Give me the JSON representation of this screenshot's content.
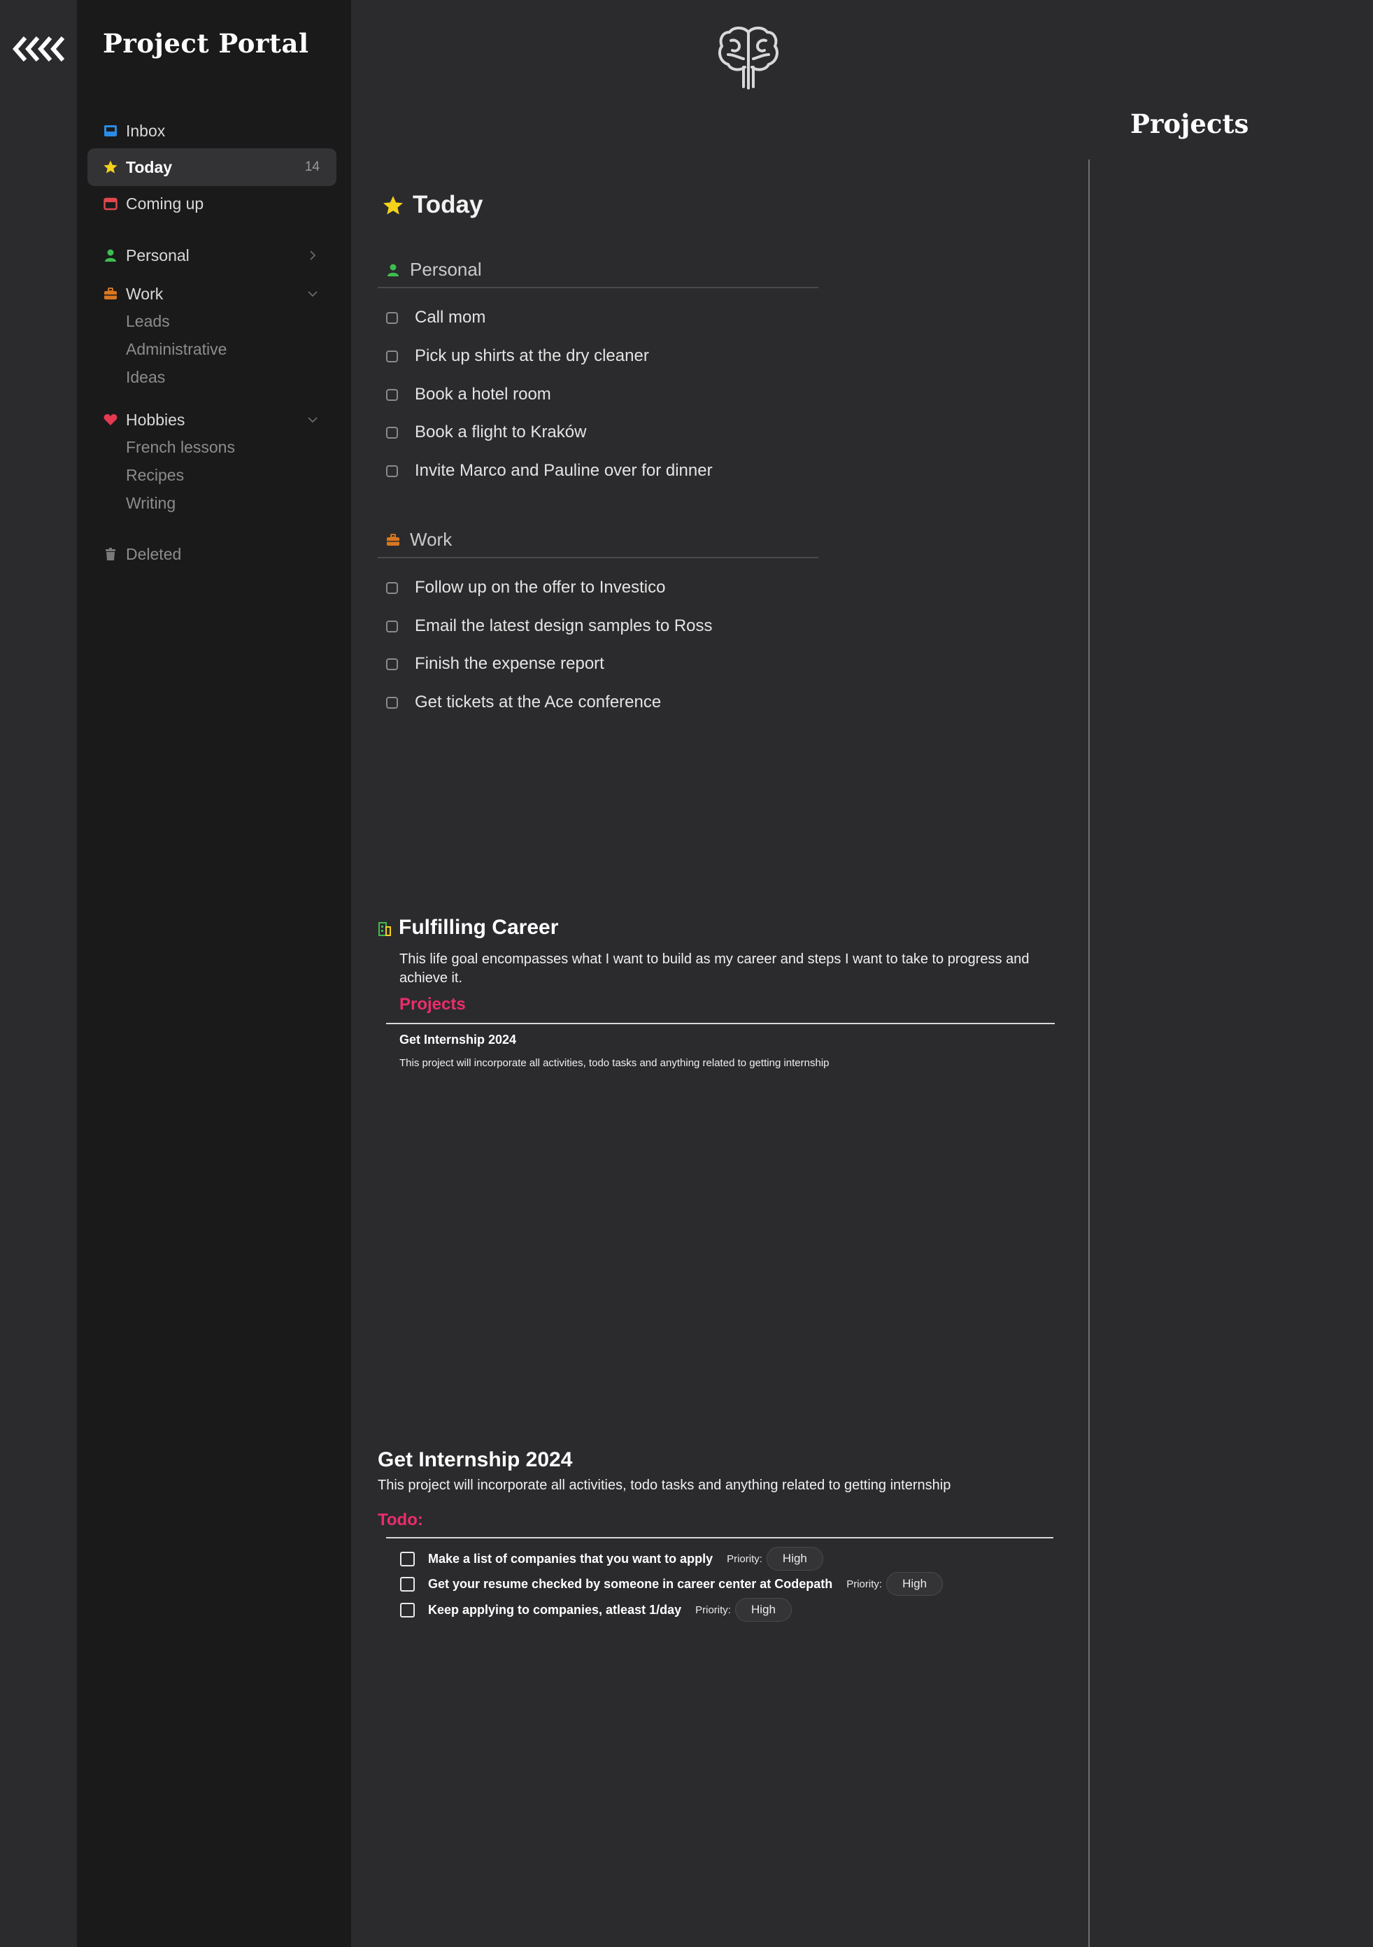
{
  "app": {
    "brand": "Project Portal",
    "right_heading": "Projects"
  },
  "colors": {
    "background": "#2b2b2d",
    "sidebar": "#1a1a1b",
    "accent_pink": "#ec2d6b",
    "inbox_blue": "#2a8ce8",
    "star_yellow": "#f4d21c",
    "calendar_red": "#e0474c",
    "person_green": "#3ebd4f",
    "work_orange": "#d8771f",
    "heart_red": "#e53950"
  },
  "sidebar": {
    "items": [
      {
        "label": "Inbox",
        "icon": "inbox-icon"
      },
      {
        "label": "Today",
        "icon": "star-icon",
        "count": "14",
        "active": true
      },
      {
        "label": "Coming up",
        "icon": "calendar-icon"
      },
      {
        "label": "Personal",
        "icon": "person-icon"
      },
      {
        "label": "Work",
        "icon": "briefcase-icon",
        "children": [
          "Leads",
          "Administrative",
          "Ideas"
        ]
      },
      {
        "label": "Hobbies",
        "icon": "heart-icon",
        "children": [
          "French lessons",
          "Recipes",
          "Writing"
        ]
      },
      {
        "label": "Deleted",
        "icon": "trash-icon"
      }
    ]
  },
  "today": {
    "title": "Today",
    "sections": [
      {
        "name": "Personal",
        "icon": "person-icon",
        "tasks": [
          "Call mom",
          "Pick up shirts at the dry cleaner",
          "Book a hotel room",
          "Book a flight to Kraków",
          "Invite Marco and Pauline over for dinner"
        ]
      },
      {
        "name": "Work",
        "icon": "briefcase-icon",
        "tasks": [
          "Follow up on the offer to Investico",
          "Email the latest design samples to Ross",
          "Finish the expense report",
          "Get tickets at the Ace conference"
        ]
      }
    ]
  },
  "goal": {
    "title": "Fulfilling Career",
    "description": "This life goal encompasses what I want to build as my career and steps I want to take to progress and achieve it.",
    "projects_label": "Projects",
    "projects": [
      {
        "title": "Get Internship 2024",
        "description": "This project will incorporate all activities, todo tasks and anything related to getting internship"
      }
    ]
  },
  "project": {
    "title": "Get Internship 2024",
    "description": "This project will incorporate all activities, todo tasks and anything related to getting internship",
    "todo_label": "Todo:",
    "todos": [
      {
        "text": "Make a list of companies that you want to apply",
        "priority_label": "Priority:",
        "priority": "High"
      },
      {
        "text": "Get your resume checked by someone in career center at Codepath",
        "priority_label": "Priority:",
        "priority": "High"
      },
      {
        "text": "Keep applying to companies, atleast 1/day",
        "priority_label": "Priority:",
        "priority": "High"
      }
    ]
  }
}
